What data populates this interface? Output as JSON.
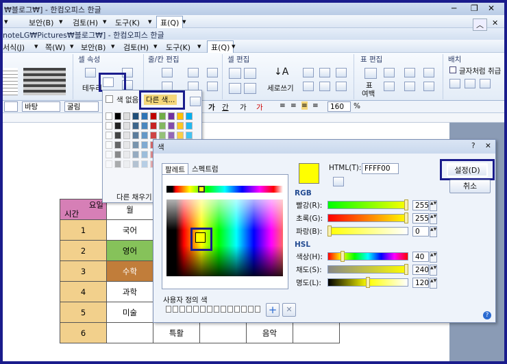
{
  "window": {
    "title_back": "₩블로그₩] - 한컴오피스 한글",
    "title_front": "noteLG₩Pictures₩블로그₩] - 한컴오피스 한글"
  },
  "menu_back": [
    "▾",
    "보안(B)",
    "▾",
    "검토(H)",
    "▾",
    "도구(K)",
    "▾",
    "표(Q)",
    "▾"
  ],
  "menu_front": [
    "서식(J)",
    "▾",
    "쪽(W)",
    "▾",
    "보안(B)",
    "▾",
    "검토(H)",
    "▾",
    "도구(K)",
    "▾",
    "표(Q)",
    "▾"
  ],
  "ribbon": {
    "groups": [
      "셀 속성",
      "줄/칸 편집",
      "셀 편집",
      "표 편집",
      "배치"
    ],
    "border_btn": "테두리",
    "vertical_btn": "세로쓰기",
    "table_btn": "표",
    "margin_btn": "여백",
    "wrap_check": "글자처럼 취급"
  },
  "format_bar": {
    "style": "바탕",
    "font": "굴림",
    "size": "160",
    "unit": "%"
  },
  "color_popup": {
    "no_color": "색 없음",
    "other_colors": "다른 색...",
    "other_fill": "다른 채우기"
  },
  "dialog": {
    "title": "색",
    "help": "?",
    "close": "✕",
    "tabs": [
      "팔레트",
      "스펙트럼"
    ],
    "html_label": "HTML(T):",
    "html_value": "FFFF00",
    "ok": "설정(D)",
    "cancel": "취소",
    "rgb_title": "RGB",
    "rgb": [
      {
        "label": "빨강(R):",
        "value": "255",
        "level": 1.0
      },
      {
        "label": "초록(G):",
        "value": "255",
        "level": 1.0
      },
      {
        "label": "파랑(B):",
        "value": "0",
        "level": 0.0
      }
    ],
    "hsl_title": "HSL",
    "hsl": [
      {
        "label": "색상(H):",
        "value": "40",
        "level": 0.17
      },
      {
        "label": "채도(S):",
        "value": "240",
        "level": 1.0
      },
      {
        "label": "명도(L):",
        "value": "120",
        "level": 0.5
      }
    ],
    "custom_title": "사용자 정의 색",
    "add": "+",
    "remove": "✕"
  },
  "table": {
    "header_top": "요일",
    "header_right": "월",
    "header_left": "시간",
    "rows": [
      [
        "1",
        "국어"
      ],
      [
        "2",
        "영어"
      ],
      [
        "3",
        "수학"
      ],
      [
        "4",
        "과학"
      ],
      [
        "5",
        "미술"
      ],
      [
        "6",
        ""
      ]
    ],
    "bottom_cells": [
      "특활",
      "음악"
    ]
  },
  "colors": {
    "selected": "#ffff00",
    "accent": "#1a1c8c",
    "english_cell": "#86c25a",
    "math_cell": "#c17d3a",
    "time_cell": "#f2d08c",
    "header_cell": "#d67fb6"
  }
}
